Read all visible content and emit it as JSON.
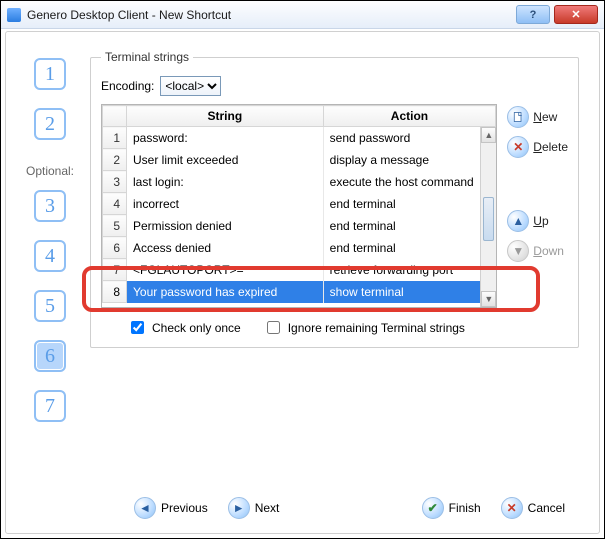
{
  "window": {
    "title": "Genero Desktop Client - New Shortcut"
  },
  "wizard": {
    "optional_label": "Optional:",
    "current_step": 6
  },
  "panel": {
    "legend": "Terminal strings",
    "encoding_label": "Encoding:",
    "encoding_value": "<local>",
    "columns": {
      "num": "",
      "string": "String",
      "action": "Action"
    },
    "rows": [
      {
        "n": "1",
        "string": "password:",
        "action": "send password"
      },
      {
        "n": "2",
        "string": "User limit exceeded",
        "action": "display a message"
      },
      {
        "n": "3",
        "string": "last login:",
        "action": "execute the host command"
      },
      {
        "n": "4",
        "string": "incorrect",
        "action": "end terminal"
      },
      {
        "n": "5",
        "string": "Permission denied",
        "action": "end terminal"
      },
      {
        "n": "6",
        "string": "Access denied",
        "action": "end terminal"
      },
      {
        "n": "7",
        "string": "<FGLAUTOPORT>=",
        "action": "retrieve forwarding port"
      },
      {
        "n": "8",
        "string": "Your password has expired",
        "action": "show terminal"
      }
    ],
    "selected_row_index": 7,
    "check_only_once": {
      "label": "Check only once",
      "checked": true
    },
    "ignore_remaining": {
      "label": "Ignore remaining Terminal strings",
      "checked": false
    }
  },
  "side": {
    "new": "New",
    "delete": "Delete",
    "up": "Up",
    "down": "Down"
  },
  "nav": {
    "previous": "Previous",
    "next": "Next",
    "finish": "Finish",
    "cancel": "Cancel"
  }
}
